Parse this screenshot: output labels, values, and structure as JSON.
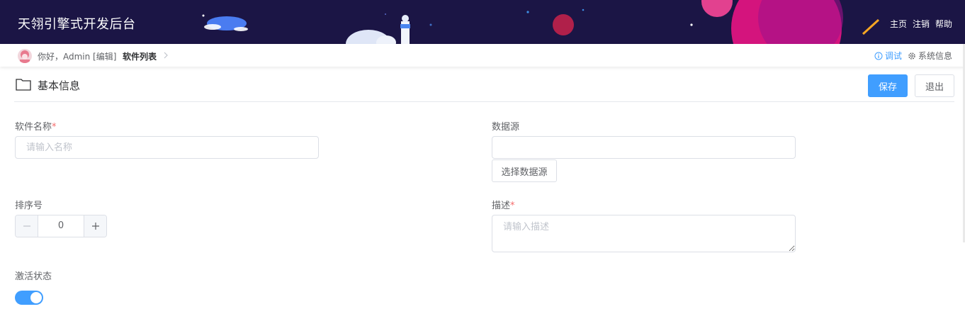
{
  "header": {
    "title": "天翎引擎式开发后台",
    "nav": [
      {
        "label": "主页"
      },
      {
        "label": "注销"
      },
      {
        "label": "帮助"
      }
    ]
  },
  "crumbbar": {
    "greeting": "你好，Admin [编辑]",
    "breadcrumb": "软件列表",
    "tools": {
      "debug": "调试",
      "system_info": "系统信息"
    }
  },
  "section": {
    "title": "基本信息",
    "save_label": "保存",
    "exit_label": "退出"
  },
  "form": {
    "name": {
      "label": "软件名称",
      "required_mark": "*",
      "placeholder": "请输入名称",
      "value": ""
    },
    "datasource": {
      "label": "数据源",
      "value": "",
      "select_button": "选择数据源"
    },
    "order": {
      "label": "排序号",
      "value": "0"
    },
    "description": {
      "label": "描述",
      "required_mark": "*",
      "placeholder": "请输入描述",
      "value": ""
    },
    "active": {
      "label": "激活状态",
      "enabled": true
    }
  },
  "colors": {
    "primary": "#409eff",
    "header_bg": "#1b1545",
    "required": "#f56c6c"
  }
}
